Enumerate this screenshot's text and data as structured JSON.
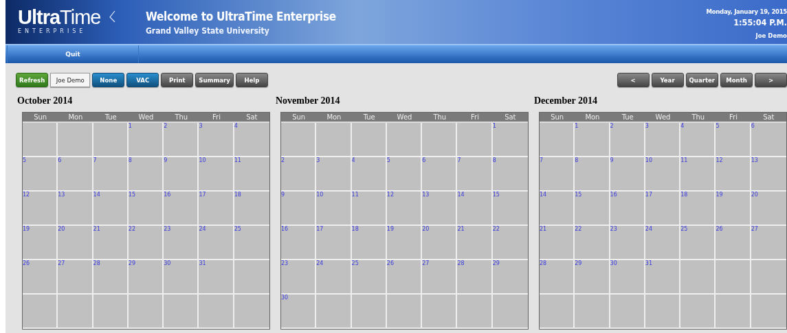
{
  "header": {
    "logo": {
      "wordmark_bold": "Ultra",
      "wordmark_light": "Time",
      "tagline": "ENTERPRISE"
    },
    "title": "Welcome to UltraTime Enterprise",
    "subtitle": "Grand Valley State University",
    "date": "Monday, January 19, 2015",
    "time": "1:55:04 P.M.",
    "user": "Joe Demo"
  },
  "nav": [
    {
      "label": "Quit"
    }
  ],
  "toolbar": [
    {
      "label": "Refresh",
      "kind": "green"
    },
    {
      "label": "Joe Demo",
      "kind": "plain"
    },
    {
      "label": "None",
      "kind": "blue"
    },
    {
      "label": "VAC",
      "kind": "blue"
    },
    {
      "label": "Print",
      "kind": "dark"
    },
    {
      "label": "Summary",
      "kind": "dark"
    },
    {
      "label": "Help",
      "kind": "dark"
    }
  ],
  "view_controls": [
    {
      "label": "<"
    },
    {
      "label": "Year"
    },
    {
      "label": "Quarter"
    },
    {
      "label": "Month"
    },
    {
      "label": ">"
    }
  ],
  "calendars": [
    {
      "title": "October 2014",
      "weekdays": [
        "Sun",
        "Mon",
        "Tue",
        "Wed",
        "Thu",
        "Fri",
        "Sat"
      ],
      "weeks": [
        [
          {
            "kind": "blank"
          },
          {
            "kind": "blank"
          },
          {
            "kind": "blank"
          },
          {
            "kind": "date",
            "day": "1"
          },
          {
            "kind": "date",
            "day": "2"
          },
          {
            "kind": "date",
            "day": "3"
          },
          {
            "kind": "date",
            "day": "4"
          }
        ],
        [
          {
            "kind": "date",
            "day": "5"
          },
          {
            "kind": "date",
            "day": "6"
          },
          {
            "kind": "date",
            "day": "7"
          },
          {
            "kind": "date",
            "day": "8"
          },
          {
            "kind": "date",
            "day": "9"
          },
          {
            "kind": "date",
            "day": "10"
          },
          {
            "kind": "date",
            "day": "11"
          }
        ],
        [
          {
            "kind": "date",
            "day": "12"
          },
          {
            "kind": "date",
            "day": "13"
          },
          {
            "kind": "date",
            "day": "14"
          },
          {
            "kind": "date",
            "day": "15"
          },
          {
            "kind": "date",
            "day": "16"
          },
          {
            "kind": "date",
            "day": "17"
          },
          {
            "kind": "date",
            "day": "18"
          }
        ],
        [
          {
            "kind": "date",
            "day": "19"
          },
          {
            "kind": "date",
            "day": "20"
          },
          {
            "kind": "date",
            "day": "21"
          },
          {
            "kind": "date",
            "day": "22"
          },
          {
            "kind": "date",
            "day": "23"
          },
          {
            "kind": "date",
            "day": "24"
          },
          {
            "kind": "date",
            "day": "25"
          }
        ],
        [
          {
            "kind": "date",
            "day": "26"
          },
          {
            "kind": "date",
            "day": "27"
          },
          {
            "kind": "date",
            "day": "28"
          },
          {
            "kind": "date",
            "day": "29"
          },
          {
            "kind": "date",
            "day": "30"
          },
          {
            "kind": "date",
            "day": "31"
          },
          {
            "kind": "blank"
          }
        ],
        [
          {
            "kind": "blank"
          },
          {
            "kind": "blank"
          },
          {
            "kind": "blank"
          },
          {
            "kind": "blank"
          },
          {
            "kind": "blank"
          },
          {
            "kind": "blank"
          },
          {
            "kind": "blank"
          }
        ]
      ]
    },
    {
      "title": "November 2014",
      "weekdays": [
        "Sun",
        "Mon",
        "Tue",
        "Wed",
        "Thu",
        "Fri",
        "Sat"
      ],
      "weeks": [
        [
          {
            "kind": "blank"
          },
          {
            "kind": "blank"
          },
          {
            "kind": "blank"
          },
          {
            "kind": "blank"
          },
          {
            "kind": "blank"
          },
          {
            "kind": "blank"
          },
          {
            "kind": "date",
            "day": "1"
          }
        ],
        [
          {
            "kind": "date",
            "day": "2"
          },
          {
            "kind": "date",
            "day": "3"
          },
          {
            "kind": "date",
            "day": "4"
          },
          {
            "kind": "date",
            "day": "5"
          },
          {
            "kind": "date",
            "day": "6"
          },
          {
            "kind": "date",
            "day": "7"
          },
          {
            "kind": "date",
            "day": "8"
          }
        ],
        [
          {
            "kind": "date",
            "day": "9"
          },
          {
            "kind": "date",
            "day": "10"
          },
          {
            "kind": "date",
            "day": "11"
          },
          {
            "kind": "date",
            "day": "12"
          },
          {
            "kind": "date",
            "day": "13"
          },
          {
            "kind": "date",
            "day": "14"
          },
          {
            "kind": "date",
            "day": "15"
          }
        ],
        [
          {
            "kind": "date",
            "day": "16"
          },
          {
            "kind": "date",
            "day": "17"
          },
          {
            "kind": "date",
            "day": "18"
          },
          {
            "kind": "date",
            "day": "19"
          },
          {
            "kind": "date",
            "day": "20"
          },
          {
            "kind": "date",
            "day": "21"
          },
          {
            "kind": "date",
            "day": "22"
          }
        ],
        [
          {
            "kind": "date",
            "day": "23"
          },
          {
            "kind": "date",
            "day": "24"
          },
          {
            "kind": "date",
            "day": "25"
          },
          {
            "kind": "date",
            "day": "26"
          },
          {
            "kind": "date",
            "day": "27"
          },
          {
            "kind": "date",
            "day": "28"
          },
          {
            "kind": "date",
            "day": "29"
          }
        ],
        [
          {
            "kind": "date",
            "day": "30"
          },
          {
            "kind": "blank"
          },
          {
            "kind": "blank"
          },
          {
            "kind": "blank"
          },
          {
            "kind": "blank"
          },
          {
            "kind": "blank"
          },
          {
            "kind": "blank"
          }
        ]
      ]
    },
    {
      "title": "December 2014",
      "weekdays": [
        "Sun",
        "Mon",
        "Tue",
        "Wed",
        "Thu",
        "Fri",
        "Sat"
      ],
      "weeks": [
        [
          {
            "kind": "blank"
          },
          {
            "kind": "date",
            "day": "1"
          },
          {
            "kind": "date",
            "day": "2"
          },
          {
            "kind": "date",
            "day": "3"
          },
          {
            "kind": "date",
            "day": "4"
          },
          {
            "kind": "date",
            "day": "5"
          },
          {
            "kind": "date",
            "day": "6"
          }
        ],
        [
          {
            "kind": "date",
            "day": "7"
          },
          {
            "kind": "date",
            "day": "8"
          },
          {
            "kind": "date",
            "day": "9"
          },
          {
            "kind": "date",
            "day": "10"
          },
          {
            "kind": "date",
            "day": "11"
          },
          {
            "kind": "date",
            "day": "12"
          },
          {
            "kind": "date",
            "day": "13"
          }
        ],
        [
          {
            "kind": "date",
            "day": "14"
          },
          {
            "kind": "date",
            "day": "15"
          },
          {
            "kind": "date",
            "day": "16"
          },
          {
            "kind": "date",
            "day": "17"
          },
          {
            "kind": "date",
            "day": "18"
          },
          {
            "kind": "date",
            "day": "19"
          },
          {
            "kind": "date",
            "day": "20"
          }
        ],
        [
          {
            "kind": "date",
            "day": "21"
          },
          {
            "kind": "date",
            "day": "22"
          },
          {
            "kind": "date",
            "day": "23"
          },
          {
            "kind": "date",
            "day": "24"
          },
          {
            "kind": "date",
            "day": "25"
          },
          {
            "kind": "date",
            "day": "26"
          },
          {
            "kind": "date",
            "day": "27"
          }
        ],
        [
          {
            "kind": "date",
            "day": "28"
          },
          {
            "kind": "date",
            "day": "29"
          },
          {
            "kind": "date",
            "day": "30"
          },
          {
            "kind": "date",
            "day": "31"
          },
          {
            "kind": "blank"
          },
          {
            "kind": "blank"
          },
          {
            "kind": "blank"
          }
        ],
        [
          {
            "kind": "blank"
          },
          {
            "kind": "blank"
          },
          {
            "kind": "blank"
          },
          {
            "kind": "blank"
          },
          {
            "kind": "blank"
          },
          {
            "kind": "blank"
          },
          {
            "kind": "blank"
          }
        ]
      ]
    }
  ]
}
